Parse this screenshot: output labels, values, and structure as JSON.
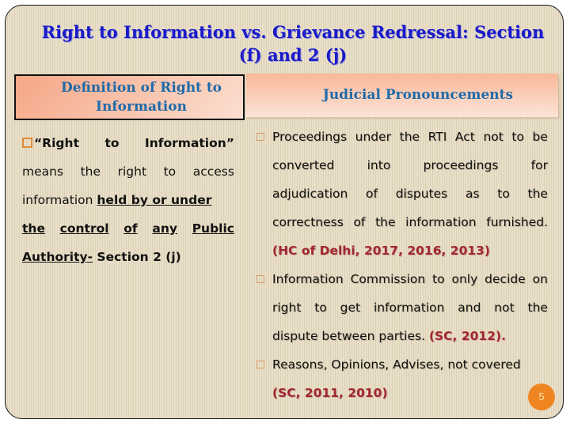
{
  "slide": {
    "title_line1": "Right to Information vs. Grievance Redressal: Section",
    "title_line2": "(f) and 2 (j)",
    "page_number": "5",
    "colors": {
      "title": "#1a1ac8",
      "header_text": "#1f6aa8",
      "citation": "#a0282e",
      "bullet_left": "#e08c38",
      "badge": "#ef8520"
    }
  },
  "left": {
    "header_line1": "Definition of Right to",
    "header_line2": "Information",
    "bullet_icon": "square-bullet-icon",
    "line1": [
      "“Right",
      "to",
      "Information”"
    ],
    "line2": [
      "means",
      "the",
      "right",
      "to",
      "access"
    ],
    "line3_plain": "information ",
    "line3_bold": "held by or under",
    "line4": [
      "the",
      "control",
      "of",
      "any",
      "Public"
    ],
    "line5_underlined": "Authority-",
    "line5_bold": " Section 2 (j)"
  },
  "right": {
    "header": "Judicial Pronouncements",
    "items": [
      {
        "lines": [
          [
            "Proceedings",
            "under",
            "the",
            "RTI",
            "Act",
            "not",
            "to",
            "be"
          ],
          [
            "converted",
            "into",
            "proceedings",
            "for"
          ],
          [
            "adjudication",
            "of",
            "disputes",
            "as",
            "to",
            "the"
          ],
          [
            "correctness",
            "of",
            "the",
            "information",
            "furnished."
          ]
        ],
        "citation": "(HC of Delhi, 2017, 2016, 2013)"
      },
      {
        "lines": [
          [
            "Information",
            "Commission",
            "to",
            "only",
            "decide",
            "on"
          ],
          [
            "right",
            "to",
            "get",
            "information",
            "and",
            "not",
            "the"
          ]
        ],
        "last_line_text": "dispute between parties. ",
        "citation": "(SC, 2012)."
      },
      {
        "last_line_text": "Reasons, Opinions, Advises, not covered",
        "citation": "(SC, 2011, 2010)"
      }
    ]
  }
}
